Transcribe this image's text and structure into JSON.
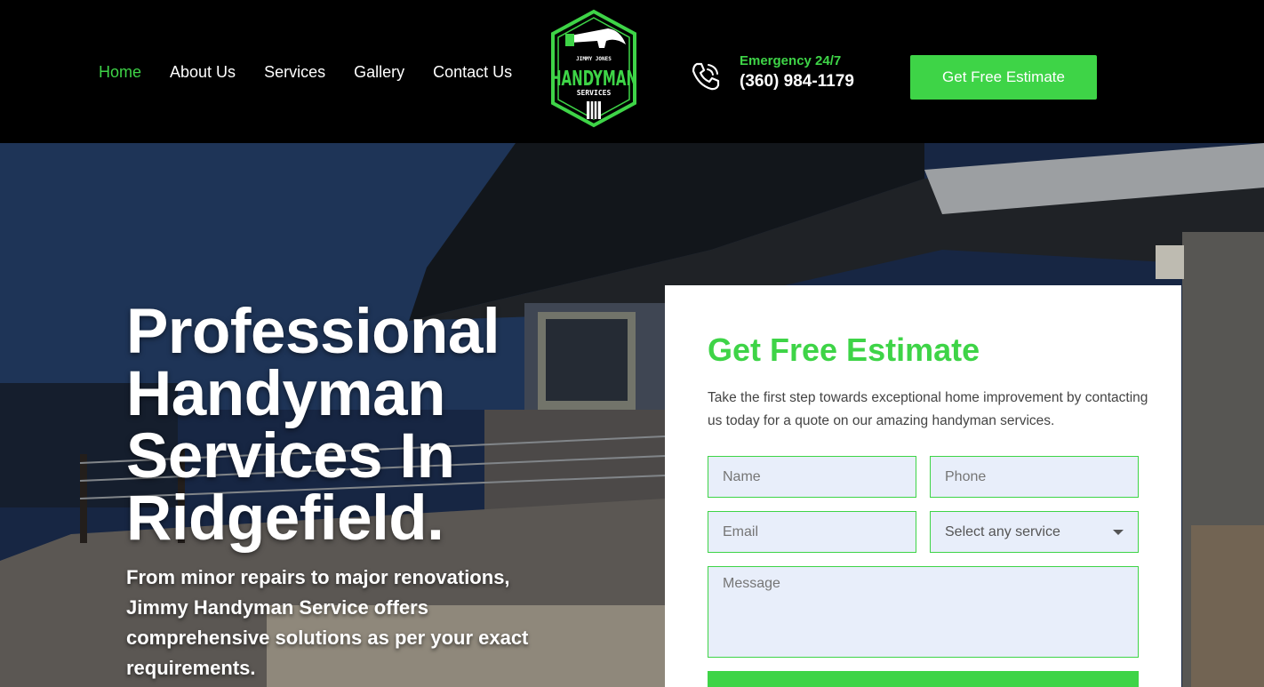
{
  "nav": {
    "items": [
      {
        "label": "Home",
        "active": true
      },
      {
        "label": "About Us",
        "active": false
      },
      {
        "label": "Services",
        "active": false
      },
      {
        "label": "Gallery",
        "active": false
      },
      {
        "label": "Contact Us",
        "active": false
      }
    ]
  },
  "logo": {
    "top_text": "JIMMY JONES",
    "main_text": "HANDYMAN",
    "bottom_text": "SERVICES",
    "icon": "hammer-icon"
  },
  "contact": {
    "emergency_label": "Emergency 24/7",
    "phone": "(360) 984-1179",
    "icon": "phone-icon"
  },
  "header_cta": {
    "label": "Get Free Estimate"
  },
  "hero": {
    "title": "Professional Handyman Services In Ridgefield.",
    "subtitle": "From minor repairs to major renovations, Jimmy Handyman Service offers comprehensive solutions as per your exact requirements."
  },
  "form": {
    "title": "Get Free Estimate",
    "description": "Take the first step towards exceptional home improvement by contacting us today for a quote on our amazing handyman services.",
    "name_placeholder": "Name",
    "phone_placeholder": "Phone",
    "email_placeholder": "Email",
    "service_selected": "Select any service",
    "message_placeholder": "Message"
  },
  "colors": {
    "accent": "#3ed447",
    "header_bg": "#000000",
    "field_bg": "#e8eefa"
  }
}
